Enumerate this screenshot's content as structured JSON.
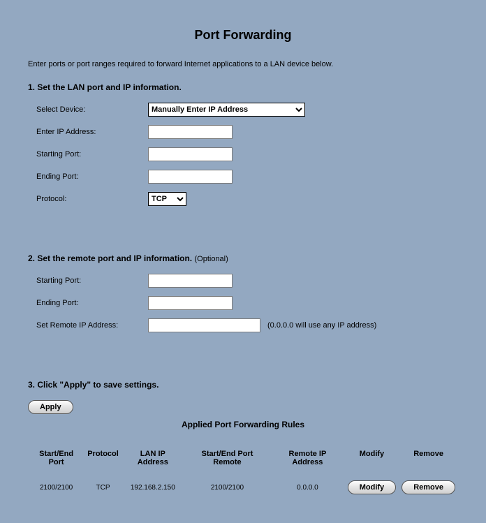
{
  "title": "Port Forwarding",
  "intro": "Enter ports or port ranges required to forward Internet applications to a LAN device below.",
  "section1": {
    "heading": "1. Set the LAN port and IP information.",
    "selectDeviceLabel": "Select Device:",
    "selectDeviceValue": "Manually Enter IP Address",
    "enterIpLabel": "Enter IP Address:",
    "enterIpValue": "",
    "startPortLabel": "Starting Port:",
    "startPortValue": "",
    "endPortLabel": "Ending Port:",
    "endPortValue": "",
    "protocolLabel": "Protocol:",
    "protocolValue": "TCP"
  },
  "section2": {
    "heading": "2. Set the remote port and IP information. ",
    "optional": "(Optional)",
    "startPortLabel": "Starting Port:",
    "startPortValue": "",
    "endPortLabel": "Ending Port:",
    "endPortValue": "",
    "remoteIpLabel": "Set Remote IP Address:",
    "remoteIpValue": "",
    "remoteIpHint": "(0.0.0.0 will use any IP address)"
  },
  "section3": {
    "heading": "3. Click \"Apply\" to save settings.",
    "applyLabel": "Apply"
  },
  "rules": {
    "title": "Applied Port Forwarding Rules",
    "headers": {
      "startEndPort": "Start/End Port",
      "protocol": "Protocol",
      "lanIp": "LAN IP Address",
      "startEndRemote": "Start/End Port Remote",
      "remoteIp": "Remote IP Address",
      "modify": "Modify",
      "remove": "Remove"
    },
    "rows": [
      {
        "startEndPort": "2100/2100",
        "protocol": "TCP",
        "lanIp": "192.168.2.150",
        "startEndRemote": "2100/2100",
        "remoteIp": "0.0.0.0",
        "modifyLabel": "Modify",
        "removeLabel": "Remove"
      }
    ]
  }
}
